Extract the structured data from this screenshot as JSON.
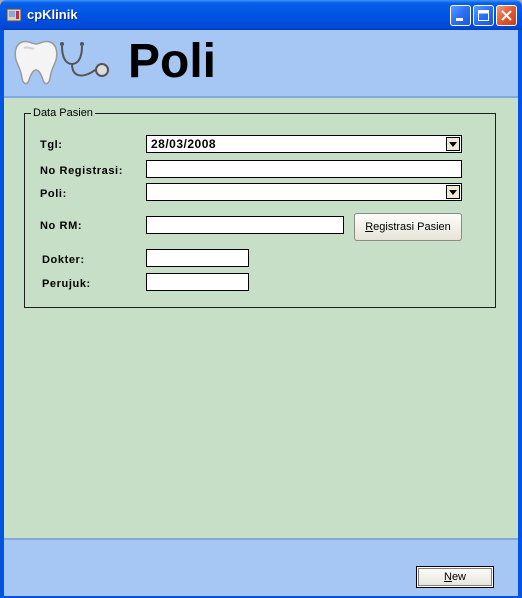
{
  "window": {
    "title": "cpKlinik"
  },
  "header": {
    "title": "Poli"
  },
  "group": {
    "legend": "Data Pasien",
    "fields": {
      "tgl_label": "Tgl:",
      "tgl_value": "28/03/2008",
      "no_registrasi_label": "No Registrasi:",
      "no_registrasi_value": "",
      "poli_label": "Poli:",
      "poli_value": "",
      "no_rm_label": "No RM:",
      "no_rm_value": "",
      "dokter_label": "Dokter:",
      "dokter_value": "",
      "perujuk_label": "Perujuk:",
      "perujuk_value": ""
    },
    "registrasi_button": {
      "accel": "R",
      "rest": "egistrasi Pasien"
    }
  },
  "footer": {
    "new_button": {
      "accel": "N",
      "rest": "ew"
    }
  },
  "icons": [
    "app-icon",
    "minimize-icon",
    "maximize-icon",
    "close-icon",
    "tooth-icon",
    "stethoscope-icon",
    "dropdown-arrow-icon"
  ],
  "colors": {
    "title_bar": "#0055e5",
    "client_bg": "#c6dfc6",
    "header_band": "#a6c7f4"
  }
}
